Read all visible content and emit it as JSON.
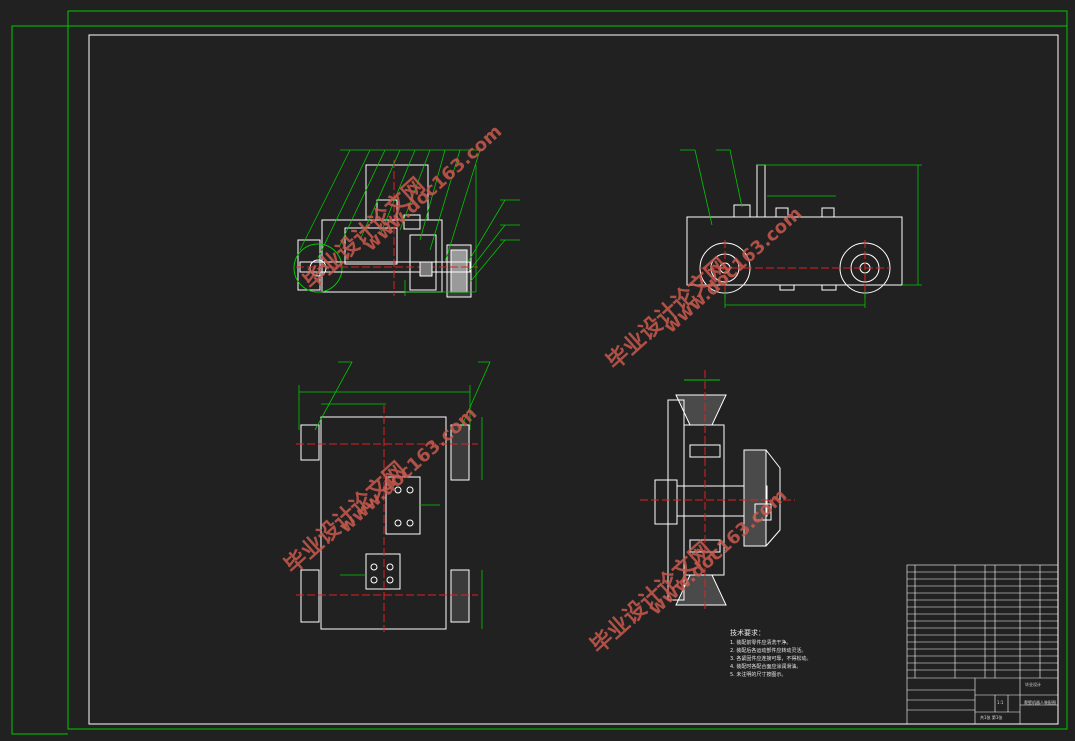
{
  "watermarks": {
    "site_name": "毕业设计论文网",
    "site_url": "www.doc163.com"
  },
  "technical_requirements": {
    "title": "技术要求：",
    "items": [
      "1. 装配前零件应清洗干净。",
      "2. 装配后各运动部件应转动灵活。",
      "3. 各紧固件应连接可靠，不得松动。",
      "4. 装配时各配合面应涂润滑油。",
      "5. 未注明的尺寸按图示。"
    ]
  },
  "title_block": {
    "drawing_name": "爬壁机器人装配图",
    "school": "毕业设计",
    "scale": "1:1",
    "sheet": "共1张 第1张"
  },
  "colors": {
    "background": "#212121",
    "frame": "#00c800",
    "outline": "#ffffff",
    "centerline": "#e02020",
    "dimension": "#00c800",
    "watermark": "#c85a4e"
  }
}
